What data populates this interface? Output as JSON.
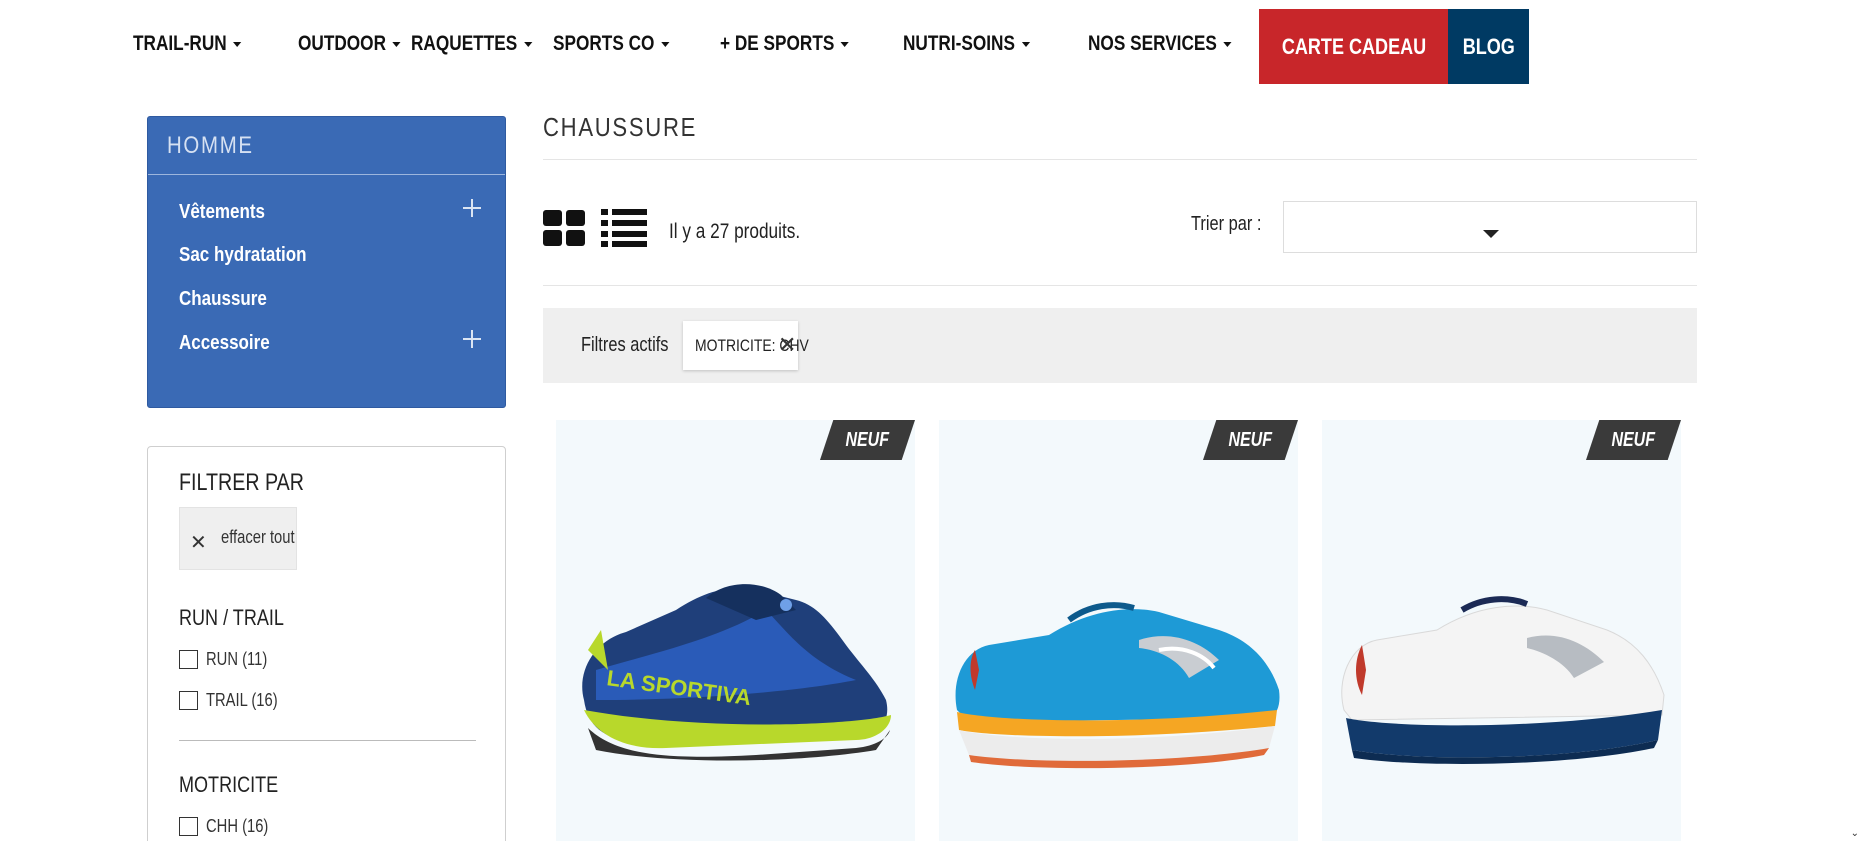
{
  "nav": {
    "items": [
      "TRAIL-RUN",
      "OUTDOOR",
      "RAQUETTES",
      "SPORTS CO",
      "+ DE SPORTS",
      "NUTRI-SOINS",
      "NOS SERVICES"
    ],
    "gift_card": "CARTE CADEAU",
    "blog": "BLOG",
    "gift_color": "#c8262a",
    "blog_color": "#003a63"
  },
  "sidebar": {
    "category_title": "HOMME",
    "categories": [
      {
        "label": "Vêtements",
        "expandable": true
      },
      {
        "label": "Sac hydratation",
        "expandable": false
      },
      {
        "label": "Chaussure",
        "expandable": false
      },
      {
        "label": "Accessoire",
        "expandable": true
      }
    ],
    "category_color": "#3a6ab5"
  },
  "filters": {
    "title": "FILTRER PAR",
    "clear_all": "effacer tout",
    "groups": [
      {
        "title": "RUN / TRAIL",
        "options": [
          "RUN (11)",
          "TRAIL (16)"
        ]
      },
      {
        "title": "MOTRICITE",
        "options": [
          "CHH (16)"
        ]
      }
    ]
  },
  "main": {
    "title": "CHAUSSURE",
    "product_count": "Il y a 27 produits.",
    "sort_label": "Trier par :",
    "sort_value": "",
    "active_filters_label": "Filtres actifs",
    "active_filter_chip": "MOTRICITE: CHV"
  },
  "products": [
    {
      "badge": "NEUF",
      "image": "blue-yellow-trail-shoe"
    },
    {
      "badge": "NEUF",
      "image": "blue-orange-running-shoe"
    },
    {
      "badge": "NEUF",
      "image": "white-navy-running-shoe"
    }
  ]
}
